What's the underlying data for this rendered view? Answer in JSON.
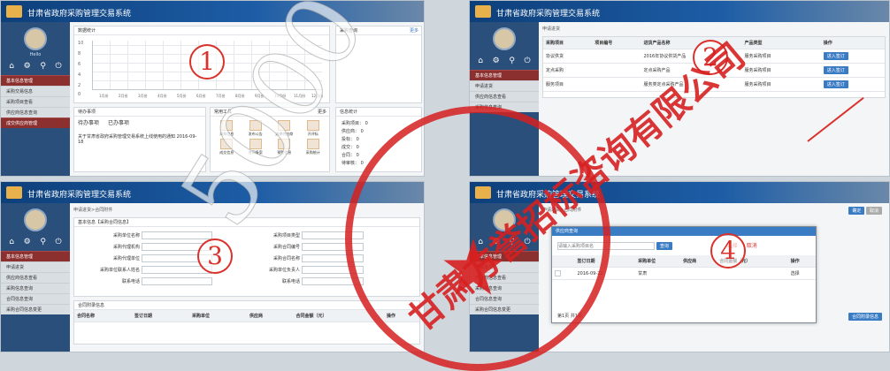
{
  "app_title": "甘肃省政府采购管理交易系统",
  "user_greeting": "Hello",
  "nav_icons": [
    "home-icon",
    "gear-icon",
    "location-icon",
    "power-icon"
  ],
  "sidebar_p1": [
    "基本信息管理",
    "采购交易信息",
    "采购项目查看",
    "供应商信息查询",
    "成交供应商管理"
  ],
  "sidebar_p2": [
    "基本信息管理",
    "申请进货",
    "供应商信息查看",
    "采购信息查询"
  ],
  "sidebar_p3": [
    "基本信息管理",
    "申请进货",
    "供应商信息查看",
    "采购信息查询",
    "合同信息查询",
    "采购合同信息变更"
  ],
  "sidebar_p4": [
    "基本信息管理",
    "申请进货",
    "供应商信息查看",
    "采购信息查询",
    "合同信息查询",
    "采购合同信息变更"
  ],
  "step_labels": [
    "1",
    "2",
    "3",
    "4"
  ],
  "p1": {
    "chart_title": "数据统计",
    "y_ticks": [
      "10",
      "8",
      "6",
      "4",
      "2",
      "0"
    ],
    "x_ticks": [
      "1月份",
      "2月份",
      "3月份",
      "4月份",
      "5月份",
      "6月份",
      "7月份",
      "8月份",
      "9月份",
      "10月份",
      "11月份",
      "12月份"
    ],
    "todo_title": "待办事项",
    "todo_tabs": [
      "待办事项",
      "已办事项"
    ],
    "todo_item": "关于甘肃省政府采购管理交易系统上线使用的通知",
    "todo_date": "2016-09-18",
    "quick_title": "常用工具",
    "quick_more": "更多",
    "quick_items": [
      "采购信息",
      "发布公告",
      "选择供应商",
      "开评标",
      "成交信息",
      "合同备案",
      "预警信息",
      "采购统计"
    ],
    "notice_title": "信息统计",
    "notice_items": [
      "采购项目：",
      "供应商：",
      "投标：",
      "成交：",
      "合同：",
      "待审核："
    ],
    "notice_values": [
      "0",
      "0",
      "0",
      "0",
      "0",
      "0"
    ],
    "right_title": "采购查询",
    "right_more": "更多"
  },
  "p2": {
    "crumb": "申请进货",
    "headers": [
      "采购项目",
      "项目编号",
      "进货产品名称",
      "产品类型",
      "",
      "操作"
    ],
    "rows": [
      {
        "a": "协议供货",
        "b": "",
        "c": "2016年协议供货产品",
        "d": "服务采购项目",
        "e": "",
        "op": "进入签订"
      },
      {
        "a": "定点采购",
        "b": "",
        "c": "定点采购产品",
        "d": "服务采购项目",
        "e": "",
        "op": "进入签订"
      },
      {
        "a": "服务项目",
        "b": "",
        "c": "服务类定点采购产品",
        "d": "服务采购项目",
        "e": "",
        "op": "进入签订"
      }
    ]
  },
  "p3": {
    "crumb": "申请进货>合同附件",
    "section": "基本信息【采购合同信息】",
    "fields_left": [
      "采购单位名称",
      "采购代理机构",
      "采购代理单位",
      "采购单位联系人姓名",
      "联系电话"
    ],
    "values_left": [
      "",
      "",
      "",
      "",
      ""
    ],
    "fields_right": [
      "采购项目类型",
      "采购合同编号",
      "采购合同名称",
      "采购单位负责人",
      "联系电话"
    ],
    "values_right": [
      "",
      "",
      "",
      "",
      ""
    ],
    "contract_title": "合同附录信息",
    "contract_headers": [
      "合同名称",
      "签订日期",
      "采购单位",
      "供应商",
      "合同金额（元）",
      "操作"
    ]
  },
  "p4": {
    "crumb": "申请进货>合同附件",
    "modal_title": "供应商查询",
    "search_placeholder": "请输入采购项目名",
    "search_button": "查询",
    "tabs": [
      "选择",
      "取消"
    ],
    "headers": [
      "",
      "签订日期",
      "采购单位",
      "供应商",
      "合同金额（元）",
      "操作"
    ],
    "row": {
      "date": "2016-09-22",
      "unit": "甘肃",
      "supplier": "",
      "amount": "",
      "op": "选择"
    },
    "pager": "第1页 共1页",
    "right_buttons": [
      "确定",
      "取消"
    ],
    "bottom_button": "合同附录信息"
  },
  "watermark": "5000",
  "seal_text": "甘肃方誉招标咨询有限公司",
  "colors": {
    "seal": "#d62020",
    "header": "#0d3f7a",
    "sidebar": "#2b4f7b",
    "sidebar_active": "#8c2f2f"
  }
}
